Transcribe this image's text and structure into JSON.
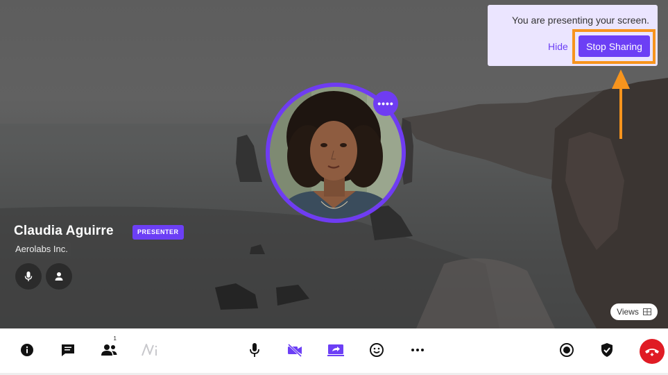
{
  "presenter": {
    "name": "Claudia Aguirre",
    "badge": "PRESENTER",
    "company": "Aerolabs Inc."
  },
  "avatar": {
    "more_label": "••••"
  },
  "views": {
    "label": "Views",
    "icon": "grid-icon"
  },
  "notification": {
    "message": "You are presenting your screen.",
    "hide_label": "Hide",
    "stop_label": "Stop Sharing"
  },
  "toolbar": {
    "participants_count": "1",
    "left_icons": [
      "info-icon",
      "chat-icon",
      "participants-icon",
      "whiteboard-icon"
    ],
    "center_icons": [
      "microphone-icon",
      "camera-off-icon",
      "screen-share-icon",
      "emoji-icon",
      "more-icon"
    ],
    "right_icons": [
      "record-icon",
      "security-shield-icon",
      "end-call-icon"
    ]
  },
  "colors": {
    "accent": "#6c3ff5",
    "highlight": "#f7941d",
    "end_call": "#e01b24",
    "notice_bg": "#ebe5ff"
  }
}
